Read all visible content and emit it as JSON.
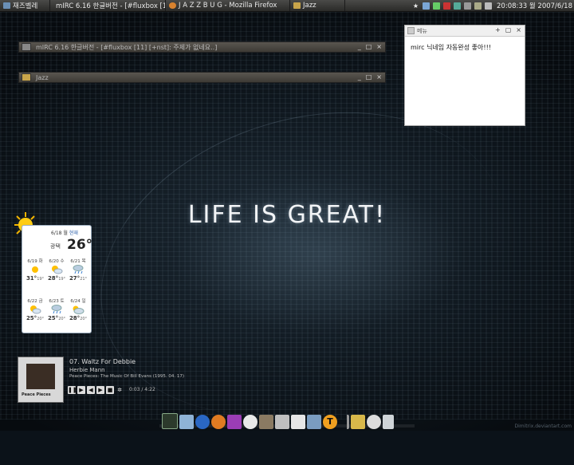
{
  "top_panel": {
    "tasks": [
      {
        "label": "재즈벨레",
        "icon": "app-menu-icon"
      },
      {
        "label": "mIRC 6.16 한글버전 - [#fluxbox [11...",
        "icon": "mirc-icon"
      },
      {
        "label": "J A Z Z B U G - Mozilla Firefox",
        "icon": "firefox-icon"
      },
      {
        "label": "Jazz",
        "icon": "folder-icon"
      }
    ],
    "clock": "20:08:33 월 2007/6/18"
  },
  "windows": {
    "mirc_title": "mIRC 6.16 한글버전 - [#fluxbox [11] [+nst]: 주제가 없네요..]",
    "jazz_title": "Jazz",
    "controls": [
      "_",
      "□",
      "×"
    ]
  },
  "note": {
    "title": "메뉴",
    "text": "mirc 닉네임 자동완성 좋아!!!",
    "controls": [
      "+",
      "▢",
      "×"
    ]
  },
  "slogan": "LIFE IS GREAT!",
  "weather": {
    "date": "6/18 월",
    "now_label": "현재",
    "location": "광택",
    "current_temp": "26°",
    "forecast": [
      {
        "day": "6/19 화",
        "high": "31°",
        "low": "19°",
        "icon": "sunny-icon"
      },
      {
        "day": "6/20 수",
        "high": "28°",
        "low": "19°",
        "icon": "sun-cloud-icon"
      },
      {
        "day": "6/21 목",
        "high": "27°",
        "low": "21°",
        "icon": "rain-icon"
      },
      {
        "day": "6/22 금",
        "high": "25°",
        "low": "20°",
        "icon": "sun-cloud-icon"
      },
      {
        "day": "6/23 토",
        "high": "25°",
        "low": "20°",
        "icon": "rain-icon"
      },
      {
        "day": "6/24 일",
        "high": "28°",
        "low": "20°",
        "icon": "cloud-icon"
      }
    ]
  },
  "music": {
    "track": "07. Waltz For Debbie",
    "artist": "Herbie Mann",
    "album": "Peace Pieces: The Music Of Bill Evans (1995. 04. 17)",
    "time": "0:03 / 4:22",
    "album_art_text": "Peace Pieces"
  },
  "dock": [
    "terminal-icon",
    "folder-icon",
    "ie-icon",
    "firefox-icon",
    "puzzle-icon",
    "media-player-icon",
    "gimp-icon",
    "image-viewer-icon",
    "document-icon",
    "transfer-icon",
    "font-t-icon",
    "pen-icon",
    "image-editor-icon",
    "clock-icon",
    "trash-icon"
  ],
  "credit": "Dimitrix.deviantart.com"
}
